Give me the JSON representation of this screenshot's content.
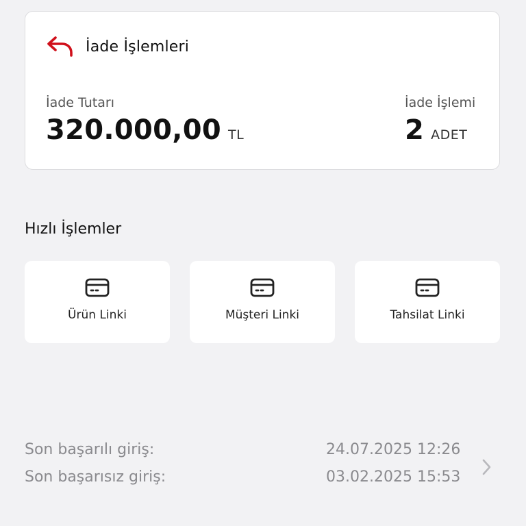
{
  "refund_card": {
    "title": "İade İşlemleri",
    "amount_label": "İade Tutarı",
    "amount_value": "320.000,00",
    "amount_unit": "TL",
    "count_label": "İade İşlemi",
    "count_value": "2",
    "count_unit": "ADET",
    "accent_color": "#d0101b"
  },
  "quick_actions": {
    "title": "Hızlı İşlemler",
    "items": [
      {
        "label": "Ürün Linki",
        "icon": "card-icon"
      },
      {
        "label": "Müşteri Linki",
        "icon": "card-icon"
      },
      {
        "label": "Tahsilat Linki",
        "icon": "card-icon"
      }
    ]
  },
  "login_info": {
    "last_success_label": "Son başarılı giriş:",
    "last_success_value": "24.07.2025 12:26",
    "last_fail_label": "Son başarısız giriş:",
    "last_fail_value": "03.02.2025 15:53",
    "icon": "chevron-right-icon"
  }
}
